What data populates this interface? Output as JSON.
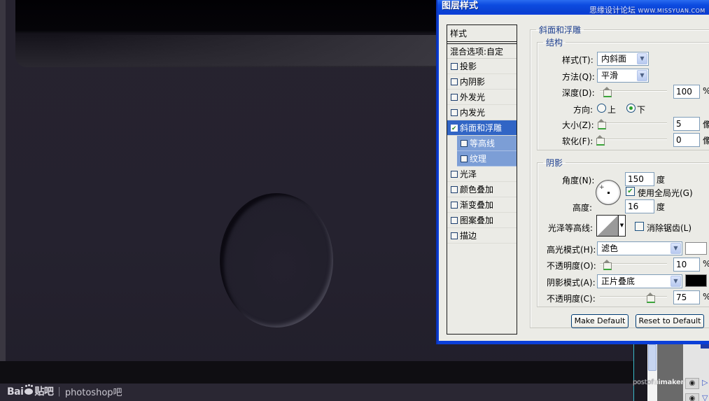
{
  "dialog": {
    "title": "图层样式",
    "forum_watermark": "思缘设计论坛",
    "forum_url": "WWW.MISSYUAN.COM"
  },
  "styles_list": {
    "header": "样式",
    "blend_options": "混合选项:自定",
    "items": [
      {
        "label": "投影",
        "checked": false,
        "selected": false,
        "sub": false
      },
      {
        "label": "内阴影",
        "checked": false,
        "selected": false,
        "sub": false
      },
      {
        "label": "外发光",
        "checked": false,
        "selected": false,
        "sub": false
      },
      {
        "label": "内发光",
        "checked": false,
        "selected": false,
        "sub": false
      },
      {
        "label": "斜面和浮雕",
        "checked": true,
        "selected": true,
        "sub": false
      },
      {
        "label": "等高线",
        "checked": false,
        "selected": false,
        "sub": true
      },
      {
        "label": "纹理",
        "checked": false,
        "selected": false,
        "sub": true
      },
      {
        "label": "光泽",
        "checked": false,
        "selected": false,
        "sub": false
      },
      {
        "label": "颜色叠加",
        "checked": false,
        "selected": false,
        "sub": false
      },
      {
        "label": "渐变叠加",
        "checked": false,
        "selected": false,
        "sub": false
      },
      {
        "label": "图案叠加",
        "checked": false,
        "selected": false,
        "sub": false
      },
      {
        "label": "描边",
        "checked": false,
        "selected": false,
        "sub": false
      }
    ]
  },
  "bevel": {
    "group_title": "斜面和浮雕",
    "structure": {
      "title": "结构",
      "style_label": "样式(T):",
      "style_value": "内斜面",
      "technique_label": "方法(Q):",
      "technique_value": "平滑",
      "depth_label": "深度(D):",
      "depth_value": "100",
      "depth_unit": "%",
      "depth_slider_fraction": 0.1,
      "direction_label": "方向:",
      "direction_up": "上",
      "direction_down": "下",
      "direction_selected": "下",
      "size_label": "大小(Z):",
      "size_value": "5",
      "size_unit": "像",
      "size_slider_fraction": 0.02,
      "soften_label": "软化(F):",
      "soften_value": "0",
      "soften_unit": "像",
      "soften_slider_fraction": 0.0
    },
    "shading": {
      "title": "阴影",
      "angle_label": "角度(N):",
      "angle_value": "150",
      "angle_unit": "度",
      "global_light_label": "使用全局光(G)",
      "global_light_checked": true,
      "altitude_label": "高度:",
      "altitude_value": "16",
      "altitude_unit": "度",
      "gloss_contour_label": "光泽等高线:",
      "anti_aliased_label": "消除锯齿(L)",
      "anti_aliased_checked": false,
      "highlight_mode_label": "高光模式(H):",
      "highlight_mode_value": "滤色",
      "highlight_color": "#ffffff",
      "highlight_opacity_label": "不透明度(O):",
      "highlight_opacity_value": "10",
      "highlight_opacity_unit": "%",
      "highlight_opacity_fraction": 0.1,
      "shadow_mode_label": "阴影模式(A):",
      "shadow_mode_value": "正片叠底",
      "shadow_color": "#000000",
      "shadow_opacity_label": "不透明度(C):",
      "shadow_opacity_value": "75",
      "shadow_opacity_unit": "%",
      "shadow_opacity_fraction": 0.75
    },
    "make_default_label": "Make Default",
    "reset_default_label": "Reset to Default"
  },
  "background": {
    "baidu_logo": "Bai",
    "baidu_logo_du": "du",
    "tieba": "贴吧",
    "separator": "|",
    "forum_name": "photoshop吧",
    "corner_watermark_prefix": "postof",
    "corner_watermark_main": "uimaker"
  }
}
